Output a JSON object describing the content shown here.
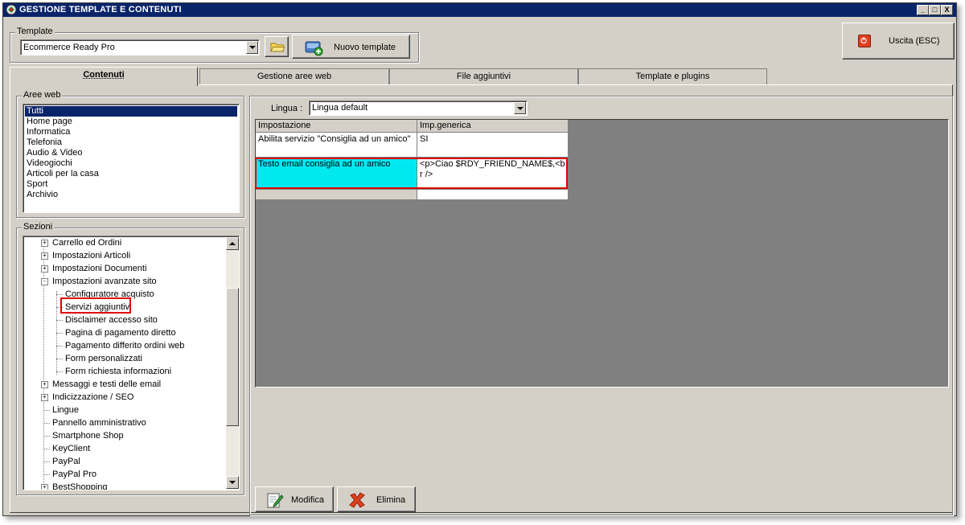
{
  "window": {
    "title": "GESTIONE TEMPLATE E CONTENUTI",
    "controls": {
      "minimize": "_",
      "maximize": "□",
      "close": "X"
    }
  },
  "template_group": {
    "label": "Template",
    "selected": "Ecommerce Ready Pro",
    "new_template_label": "Nuovo template"
  },
  "exit_button": {
    "label": "Uscita (ESC)"
  },
  "tabs": [
    {
      "label": "Contenuti",
      "active": true
    },
    {
      "label": "Gestione aree web",
      "active": false
    },
    {
      "label": "File aggiuntivi",
      "active": false
    },
    {
      "label": "Template e plugins",
      "active": false
    }
  ],
  "aree_web": {
    "label": "Aree web",
    "items": [
      "Tutti",
      "Home page",
      "Informatica",
      "Telefonia",
      "Audio & Video",
      "Videogiochi",
      "Articoli per la casa",
      "Sport",
      "Archivio"
    ],
    "selected_index": 0
  },
  "sezioni": {
    "label": "Sezioni",
    "nodes": [
      {
        "label": "Carrello ed Ordini",
        "level": 0,
        "expander": "+"
      },
      {
        "label": "Impostazioni Articoli",
        "level": 0,
        "expander": "+"
      },
      {
        "label": "Impostazioni Documenti",
        "level": 0,
        "expander": "+"
      },
      {
        "label": "Impostazioni avanzate sito",
        "level": 0,
        "expander": "-"
      },
      {
        "label": "Configuratore acquisto",
        "level": 1,
        "expander": ""
      },
      {
        "label": "Servizi aggiuntivi",
        "level": 1,
        "expander": "",
        "highlighted": true
      },
      {
        "label": "Disclaimer accesso sito",
        "level": 1,
        "expander": ""
      },
      {
        "label": "Pagina di pagamento diretto",
        "level": 1,
        "expander": ""
      },
      {
        "label": "Pagamento differito ordini web",
        "level": 1,
        "expander": ""
      },
      {
        "label": "Form personalizzati",
        "level": 1,
        "expander": ""
      },
      {
        "label": "Form richiesta informazioni",
        "level": 1,
        "expander": ""
      },
      {
        "label": "Messaggi e testi delle email",
        "level": 0,
        "expander": "+"
      },
      {
        "label": "Indicizzazione / SEO",
        "level": 0,
        "expander": "+"
      },
      {
        "label": "Lingue",
        "level": 0,
        "expander": ""
      },
      {
        "label": "Pannello amministrativo",
        "level": 0,
        "expander": ""
      },
      {
        "label": "Smartphone Shop",
        "level": 0,
        "expander": ""
      },
      {
        "label": "KeyClient",
        "level": 0,
        "expander": ""
      },
      {
        "label": "PayPal",
        "level": 0,
        "expander": ""
      },
      {
        "label": "PayPal Pro",
        "level": 0,
        "expander": ""
      },
      {
        "label": "BestShopping",
        "level": 0,
        "expander": "+"
      }
    ]
  },
  "lingua": {
    "label": "Lingua :",
    "selected": "Lingua default"
  },
  "grid": {
    "headers": [
      "Impostazione",
      "Imp.generica"
    ],
    "rows": [
      {
        "setting": "Abilita servizio \"Consiglia ad un amico\"",
        "value": "SI"
      },
      {
        "setting": "Testo email consiglia ad un amico",
        "value": "<p>Ciao $RDY_FRIEND_NAME$,<br />",
        "highlighted": true
      }
    ]
  },
  "actions": {
    "edit_label": "Modifica",
    "delete_label": "Elimina"
  }
}
